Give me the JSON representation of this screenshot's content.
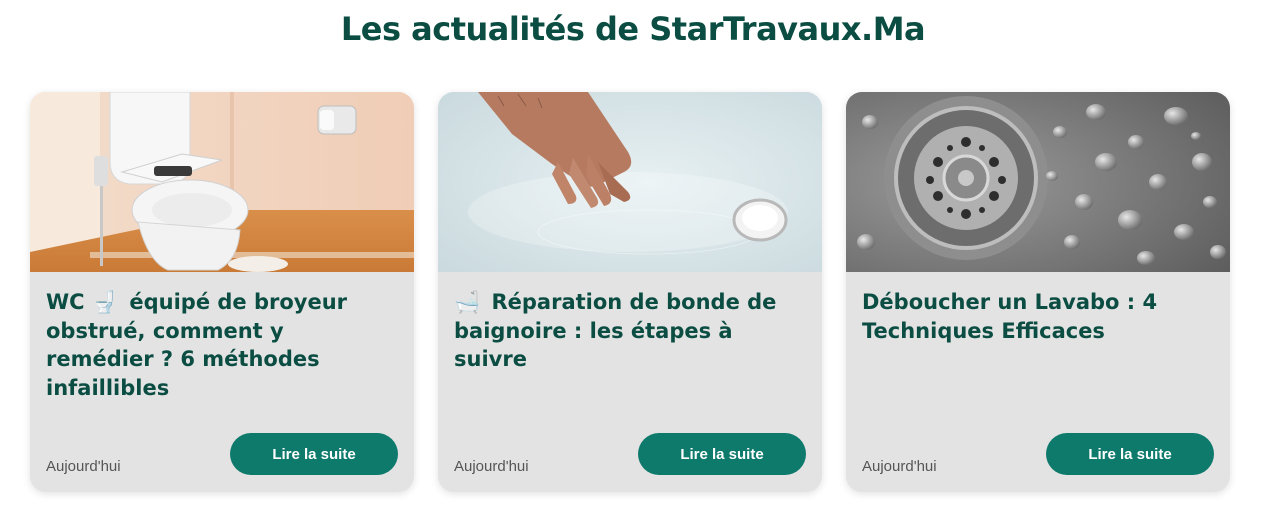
{
  "section": {
    "title": "Les actualités de StarTravaux.Ma"
  },
  "colors": {
    "heading": "#0b4d42",
    "button": "#0e7a6c",
    "card_bg": "#e3e3e3"
  },
  "articles": [
    {
      "image": "toilet-photo",
      "title_before": "WC",
      "title_icon": "toilet-icon",
      "title_icon_glyph": "🚽",
      "title_after": "équipé de broyeur obstrué, comment y remédier ? 6 méthodes infaillibles",
      "date": "Aujourd'hui",
      "button_label": "Lire la suite"
    },
    {
      "image": "bathtub-drain-photo",
      "title_icon": "bathtub-icon",
      "title_icon_glyph": "🛁",
      "title_after": "Réparation de bonde de baignoire : les étapes à suivre",
      "date": "Aujourd'hui",
      "button_label": "Lire la suite"
    },
    {
      "image": "sink-drain-photo",
      "title_after": "Déboucher un Lavabo : 4 Techniques Efficaces",
      "date": "Aujourd'hui",
      "button_label": "Lire la suite"
    }
  ]
}
